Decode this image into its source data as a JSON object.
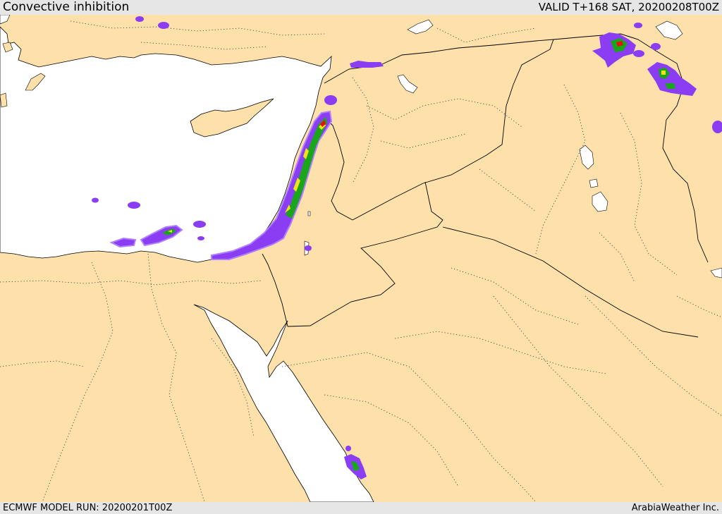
{
  "header": {
    "title": "Convective inhibition",
    "valid": "VALID T+168 SAT, 20200208T00Z"
  },
  "footer": {
    "model_run": "ECMWF MODEL RUN: 20200201T00Z",
    "credit": "ArabiaWeather Inc."
  },
  "colors": {
    "land": "#fde0aa",
    "water": "#ffffff",
    "border": "#000000",
    "cin_purple": "#8a3df2",
    "cin_green": "#1aa51a",
    "cin_yellow": "#f0e21a",
    "cin_red": "#e81010"
  }
}
